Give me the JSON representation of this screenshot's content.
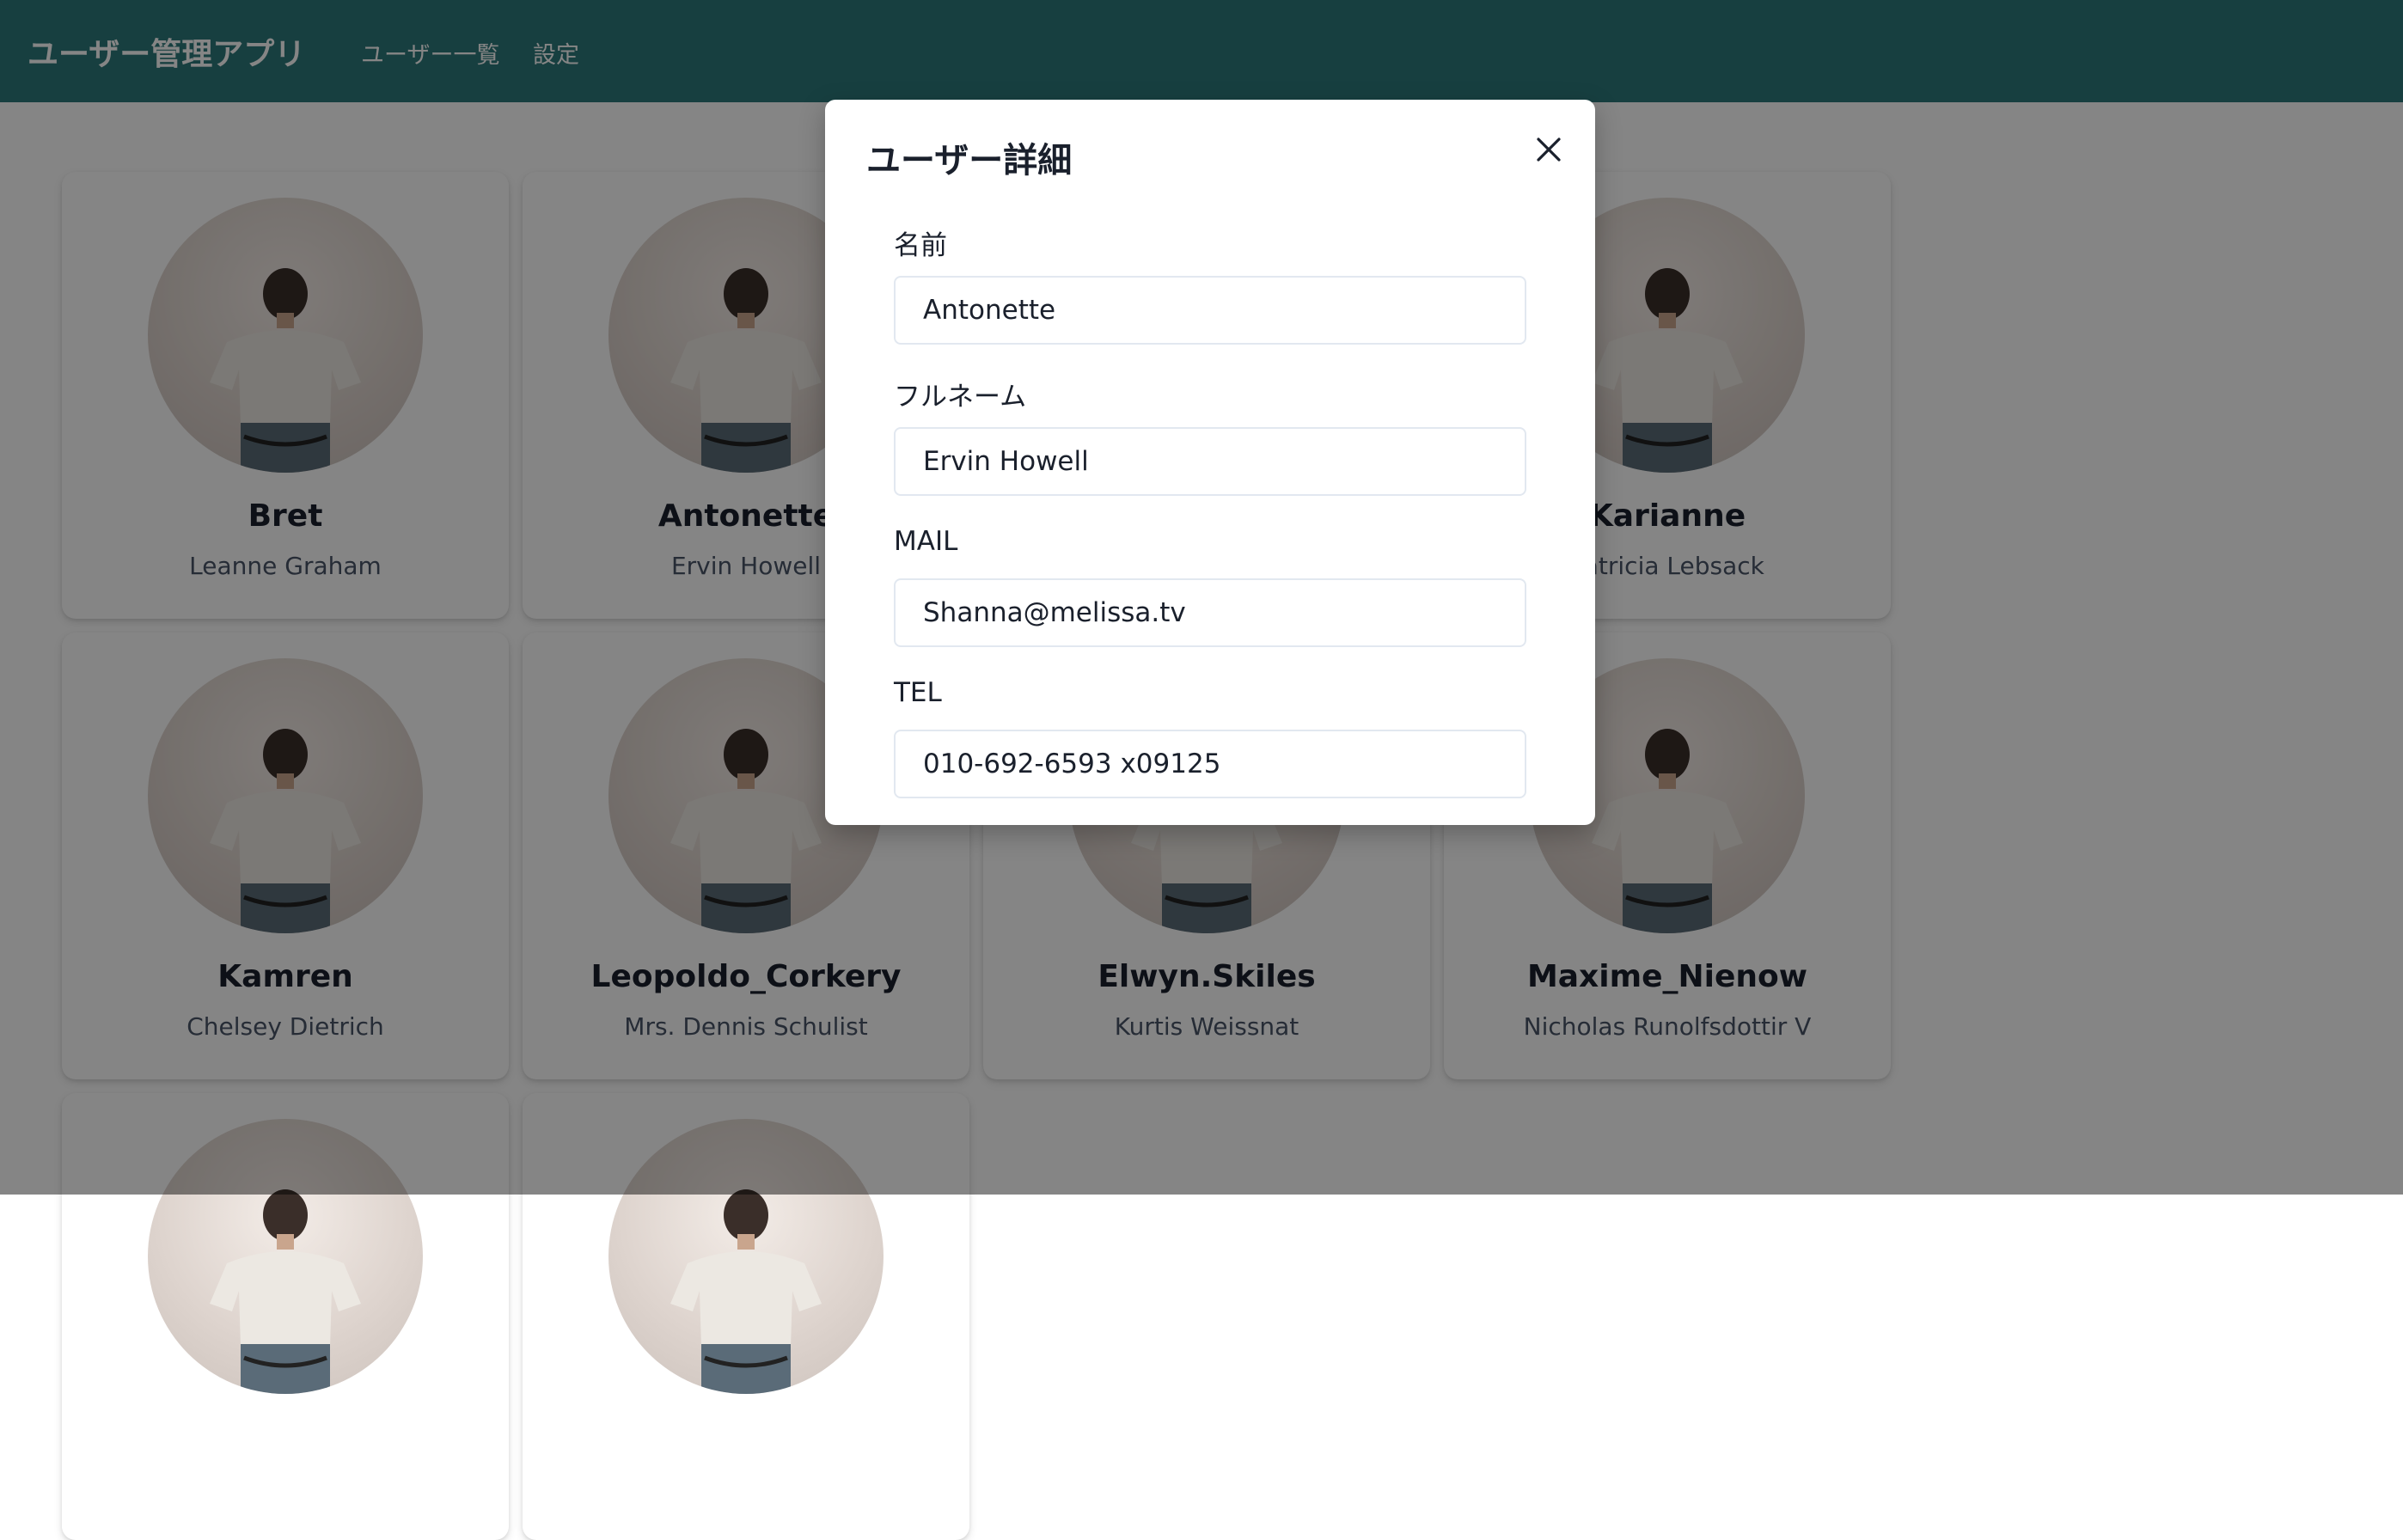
{
  "header": {
    "app_title": "ユーザー管理アプリ",
    "nav": [
      "ユーザー一覧",
      "設定"
    ]
  },
  "users": [
    {
      "username": "Bret",
      "name": "Leanne Graham"
    },
    {
      "username": "Antonette",
      "name": "Ervin Howell"
    },
    {
      "username": "",
      "name": ""
    },
    {
      "username": "Karianne",
      "name": "Patricia Lebsack"
    },
    {
      "username": "Kamren",
      "name": "Chelsey Dietrich"
    },
    {
      "username": "Leopoldo_Corkery",
      "name": "Mrs. Dennis Schulist"
    },
    {
      "username": "Elwyn.Skiles",
      "name": "Kurtis Weissnat"
    },
    {
      "username": "Maxime_Nienow",
      "name": "Nicholas Runolfsdottir V"
    },
    {
      "username": "",
      "name": ""
    },
    {
      "username": "",
      "name": ""
    }
  ],
  "modal": {
    "title": "ユーザー詳細",
    "fields": [
      {
        "label": "名前",
        "value": "Antonette"
      },
      {
        "label": "フルネーム",
        "value": "Ervin Howell"
      },
      {
        "label": "MAIL",
        "value": "Shanna@melissa.tv"
      },
      {
        "label": "TEL",
        "value": "010-692-6593 x09125"
      }
    ]
  },
  "colors": {
    "header_bg": "#2c7a7b",
    "overlay": "rgba(0,0,0,0.48)",
    "card_bg": "#ffffff"
  },
  "icons": {
    "close": "close-icon",
    "avatar": "avatar"
  }
}
